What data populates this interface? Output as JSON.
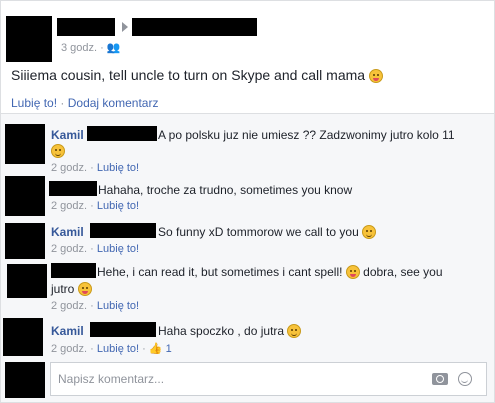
{
  "post": {
    "time": "3 godz.",
    "audience_icon": "friends-icon",
    "text": "Siiiema cousin, tell uncle to turn on Skype and call mama",
    "like_label": "Lubię to!",
    "comment_label": "Dodaj komentarz"
  },
  "comments": [
    {
      "name": "Kamil",
      "text": "A po polsku juz nie umiesz ?? Zadzwonimy jutro kolo 11",
      "time": "2 godz.",
      "like_label": "Lubię to!"
    },
    {
      "name": "",
      "text": "Hahaha, troche za trudno, sometimes you know",
      "time": "2 godz.",
      "like_label": "Lubię to!"
    },
    {
      "name": "Kamil",
      "text": "So funny xD tommorow we call to you",
      "time": "2 godz.",
      "like_label": "Lubię to!"
    },
    {
      "name": "",
      "text": "Hehe, i can read it, but sometimes i cant spell!",
      "text2": "dobra, see you",
      "text3": "jutro",
      "time": "2 godz.",
      "like_label": "Lubię to!"
    },
    {
      "name": "Kamil",
      "text": "Haha spoczko , do jutra",
      "time": "2 godz.",
      "like_label": "Lubię to!",
      "like_count": "1"
    }
  ],
  "composer": {
    "placeholder": "Napisz komentarz..."
  },
  "colors": {
    "link": "#4267b2",
    "name": "#365899",
    "meta": "#90949c"
  }
}
